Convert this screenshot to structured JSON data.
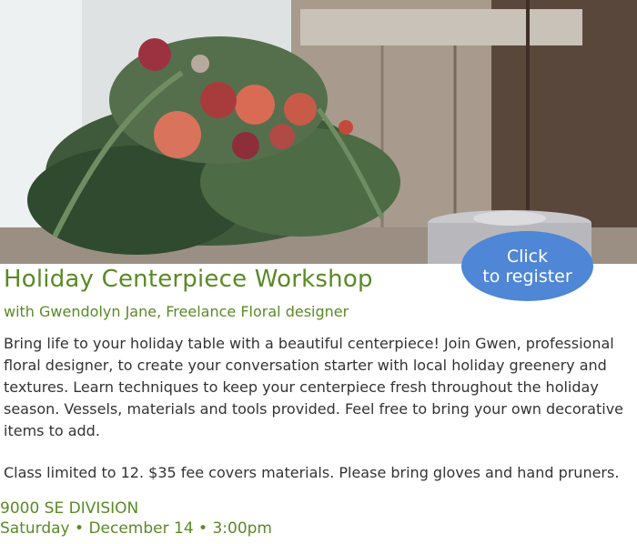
{
  "hero": {
    "image": "floral-centerpiece-photo"
  },
  "register": {
    "line1": "Click",
    "line2": "to register"
  },
  "event": {
    "title": "Holiday Centerpiece Workshop",
    "subtitle": "with Gwendolyn Jane, Freelance Floral designer",
    "description": "Bring life to your holiday table with a beautiful centerpiece! Join Gwen, professional floral designer, to create your conversation starter with local holiday greenery and textures. Learn techniques to keep your centerpiece fresh throughout the holiday season. Vessels, materials and tools provided. Feel free to bring your own decorative items to add.",
    "note": "Class limited to 12. $35 fee covers materials. Please bring gloves and hand pruners.",
    "address": "9000 SE DIVISION",
    "datetime": "Saturday • December 14 • 3:00pm"
  },
  "colors": {
    "accent": "#5a8a26",
    "button": "#4f86d6",
    "text": "#333333"
  }
}
